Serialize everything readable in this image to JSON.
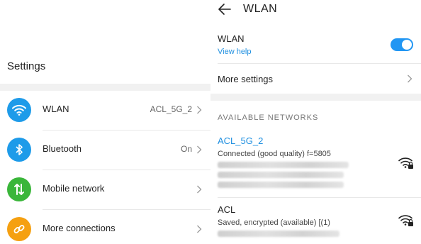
{
  "left": {
    "title": "Settings",
    "items": [
      {
        "label": "WLAN",
        "value": "ACL_5G_2",
        "icon": "wifi-icon",
        "color": "#1e9be9"
      },
      {
        "label": "Bluetooth",
        "value": "On",
        "icon": "bluetooth-icon",
        "color": "#1e9be9"
      },
      {
        "label": "Mobile network",
        "value": "",
        "icon": "mobile-data-icon",
        "color": "#3ab63a"
      },
      {
        "label": "More connections",
        "value": "",
        "icon": "link-icon",
        "color": "#f5a011"
      }
    ]
  },
  "right": {
    "header_title": "WLAN",
    "wlan_label": "WLAN",
    "view_help": "View help",
    "wlan_enabled": true,
    "more_settings": "More settings",
    "available_header": "AVAILABLE NETWORKS",
    "networks": [
      {
        "name": "ACL_5G_2",
        "status": "Connected (good quality)  f=5805",
        "name_color": "#1e8fe0"
      },
      {
        "name": "ACL",
        "status": "Saved, encrypted (available)  [(1)",
        "name_color": "#222222"
      }
    ]
  },
  "colors": {
    "accent": "#2196f3",
    "link": "#1e8fe0"
  }
}
